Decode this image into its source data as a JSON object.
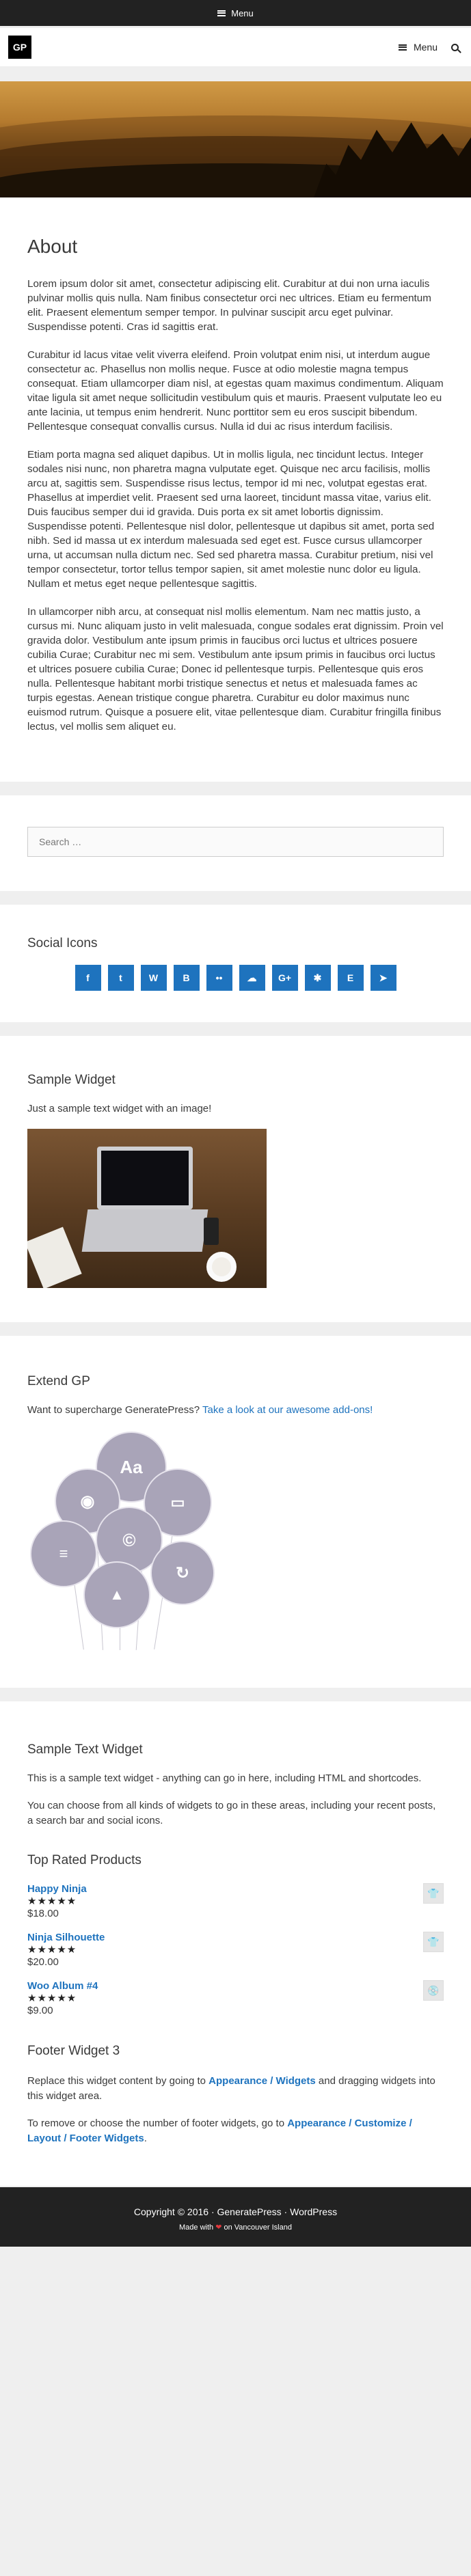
{
  "topbar": {
    "menu_label": "Menu"
  },
  "header": {
    "logo_text": "GP",
    "menu_label": "Menu"
  },
  "page": {
    "title": "About",
    "paragraphs": [
      "Lorem ipsum dolor sit amet, consectetur adipiscing elit. Curabitur at dui non urna iaculis pulvinar mollis quis nulla. Nam finibus consectetur orci nec ultrices. Etiam eu fermentum elit. Praesent elementum semper tempor. In pulvinar suscipit arcu eget pulvinar. Suspendisse potenti. Cras id sagittis erat.",
      "Curabitur id lacus vitae velit viverra eleifend. Proin volutpat enim nisi, ut interdum augue consectetur ac. Phasellus non mollis neque. Fusce at odio molestie magna tempus consequat. Etiam ullamcorper diam nisl, at egestas quam maximus condimentum. Aliquam vitae ligula sit amet neque sollicitudin vestibulum quis et mauris. Praesent vulputate leo eu ante lacinia, ut tempus enim hendrerit. Nunc porttitor sem eu eros suscipit bibendum. Pellentesque consequat convallis cursus. Nulla id dui ac risus interdum facilisis.",
      "Etiam porta magna sed aliquet dapibus. Ut in mollis ligula, nec tincidunt lectus. Integer sodales nisi nunc, non pharetra magna vulputate eget. Quisque nec arcu facilisis, mollis arcu at, sagittis sem. Suspendisse risus lectus, tempor id mi nec, volutpat egestas erat. Phasellus at imperdiet velit. Praesent sed urna laoreet, tincidunt massa vitae, varius elit. Duis faucibus semper dui id gravida. Duis porta ex sit amet lobortis dignissim. Suspendisse potenti. Pellentesque nisl dolor, pellentesque ut dapibus sit amet, porta sed nibh. Sed id massa ut ex interdum malesuada sed eget est. Fusce cursus ullamcorper urna, ut accumsan nulla dictum nec. Sed sed pharetra massa. Curabitur pretium, nisi vel tempor consectetur, tortor tellus tempor sapien, sit amet molestie nunc dolor eu ligula. Nullam et metus eget neque pellentesque sagittis.",
      "In ullamcorper nibh arcu, at consequat nisl mollis elementum. Nam nec mattis justo, a cursus mi. Nunc aliquam justo in velit malesuada, congue sodales erat dignissim. Proin vel gravida dolor. Vestibulum ante ipsum primis in faucibus orci luctus et ultrices posuere cubilia Curae; Curabitur nec mi sem. Vestibulum ante ipsum primis in faucibus orci luctus et ultrices posuere cubilia Curae; Donec id pellentesque turpis. Pellentesque quis eros nulla. Pellentesque habitant morbi tristique senectus et netus et malesuada fames ac turpis egestas. Aenean tristique congue pharetra. Curabitur eu dolor maximus nunc euismod rutrum. Quisque a posuere elit, vitae pellentesque diam. Curabitur fringilla finibus lectus, vel mollis sem aliquet eu."
    ]
  },
  "search": {
    "placeholder": "Search …"
  },
  "social": {
    "title": "Social Icons",
    "icons": [
      {
        "name": "facebook-icon",
        "glyph": "f"
      },
      {
        "name": "twitter-icon",
        "glyph": "t"
      },
      {
        "name": "wordpress-icon",
        "glyph": "W"
      },
      {
        "name": "blogger-icon",
        "glyph": "B"
      },
      {
        "name": "flickr-icon",
        "glyph": "••"
      },
      {
        "name": "soundcloud-icon",
        "glyph": "☁"
      },
      {
        "name": "googleplus-icon",
        "glyph": "G+"
      },
      {
        "name": "jsfiddle-icon",
        "glyph": "✱"
      },
      {
        "name": "evernote-icon",
        "glyph": "E"
      },
      {
        "name": "telegram-icon",
        "glyph": "➤"
      }
    ]
  },
  "sample_widget": {
    "title": "Sample Widget",
    "text": "Just a sample text widget with an image!"
  },
  "extend": {
    "title": "Extend GP",
    "text": "Want to supercharge GeneratePress?",
    "link_text": "Take a look at our awesome add-ons!",
    "balloon_label": "Aa"
  },
  "text_widget": {
    "title": "Sample Text Widget",
    "p1": "This is a sample text widget - anything can go in here, including HTML and shortcodes.",
    "p2": "You can choose from all kinds of widgets to go in these areas, including your recent posts, a search bar and social icons."
  },
  "top_rated": {
    "title": "Top Rated Products",
    "products": [
      {
        "name": "Happy Ninja",
        "stars": "★★★★★",
        "price": "$18.00",
        "thumb": "👕"
      },
      {
        "name": "Ninja Silhouette",
        "stars": "★★★★★",
        "price": "$20.00",
        "thumb": "👕"
      },
      {
        "name": "Woo Album #4",
        "stars": "★★★★★",
        "price": "$9.00",
        "thumb": "💿"
      }
    ]
  },
  "footer_widget": {
    "title": "Footer Widget 3",
    "p1_before": "Replace this widget content by going to ",
    "p1_link": "Appearance / Widgets",
    "p1_after": " and dragging widgets into this widget area.",
    "p2_before": "To remove or choose the number of footer widgets, go to ",
    "p2_link": "Appearance / Customize / Layout / Footer Widgets",
    "p2_after": "."
  },
  "footer": {
    "copyright": "Copyright © 2016 · GeneratePress · WordPress",
    "made_before": "Made with",
    "made_after": "on Vancouver Island",
    "heart": "❤"
  }
}
